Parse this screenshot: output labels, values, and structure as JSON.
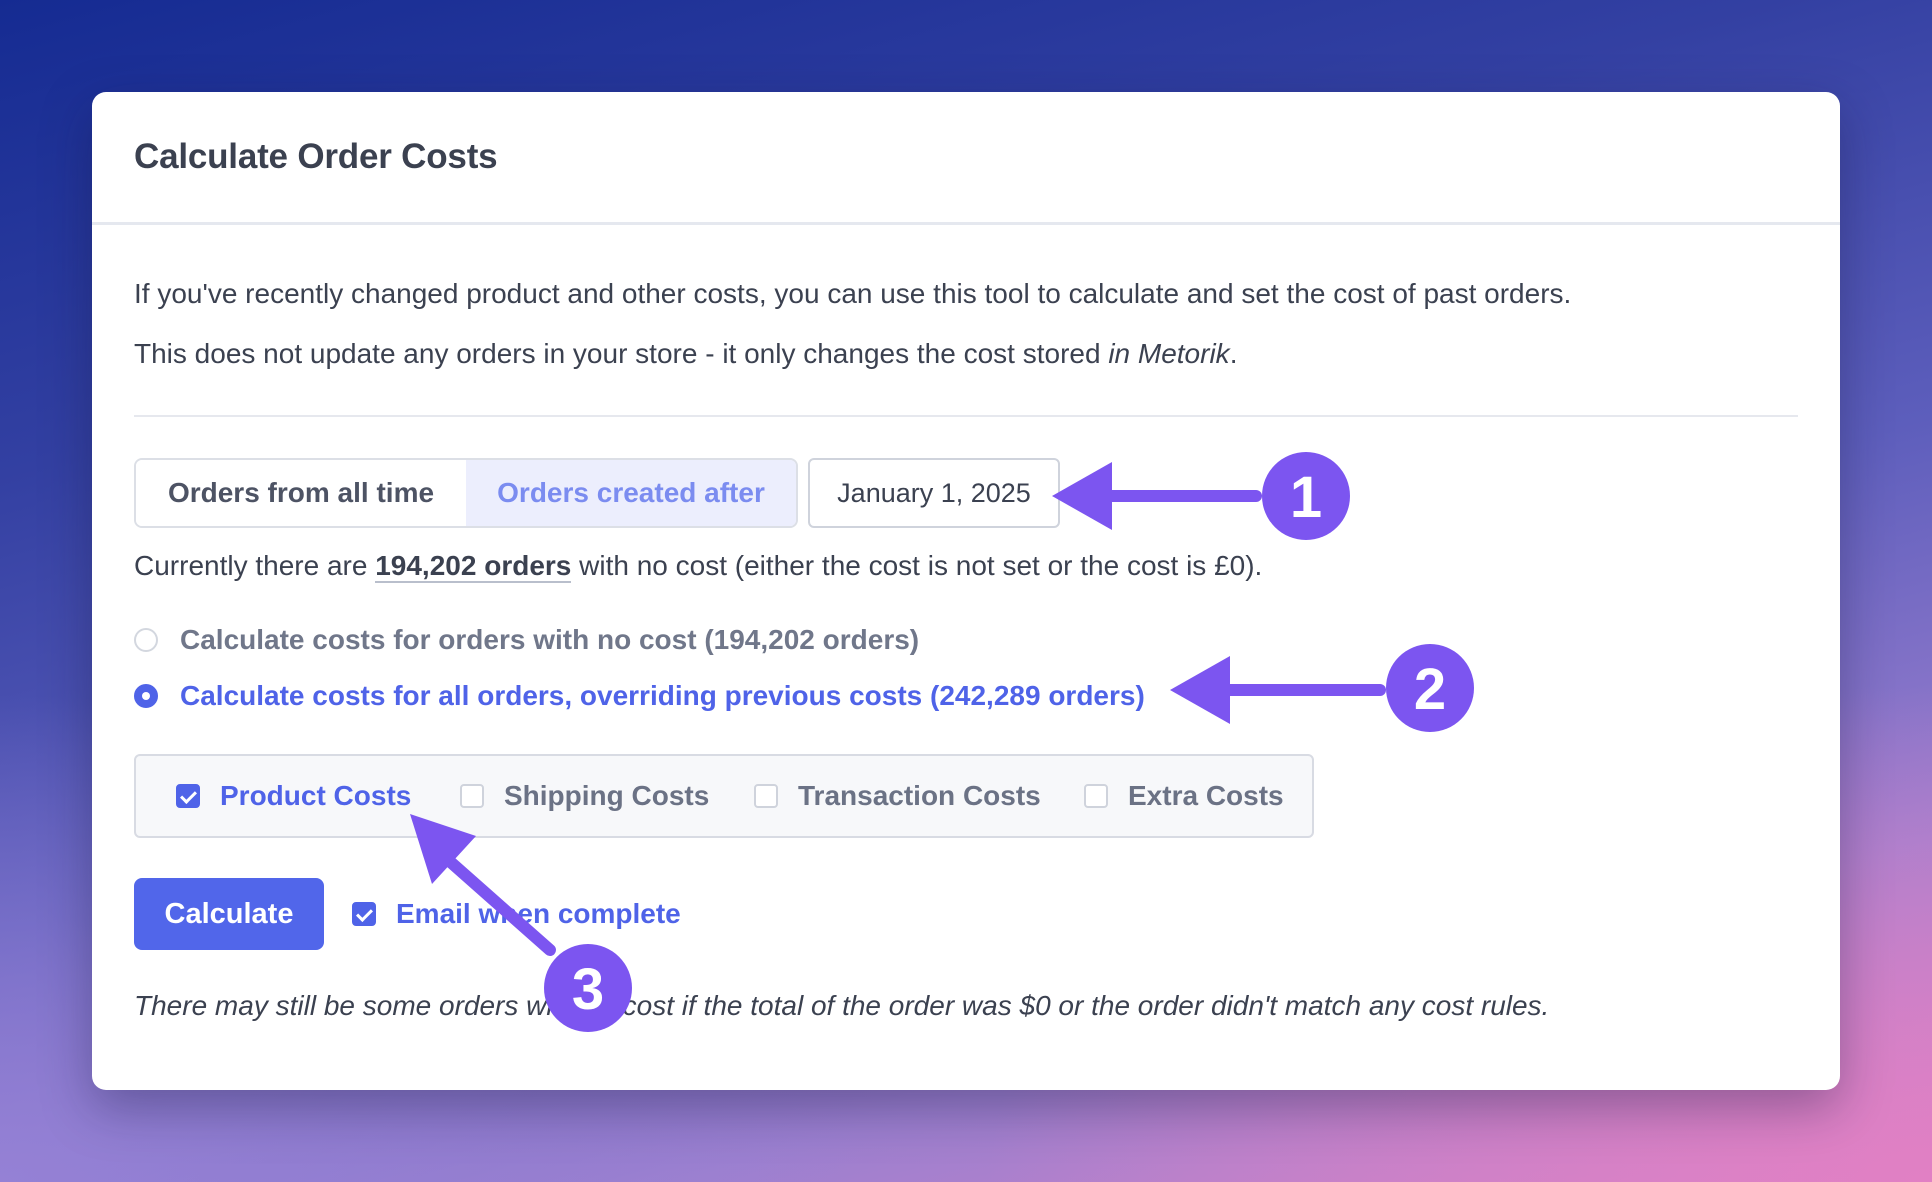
{
  "card": {
    "title": "Calculate Order Costs",
    "intro": "If you've recently changed product and other costs, you can use this tool to calculate and set the cost of past orders.",
    "notice_prefix": "This does not update any orders in your store - it only changes the cost stored ",
    "notice_emphasis": "in Metorik",
    "notice_suffix": "."
  },
  "range_toggle": {
    "options": [
      "Orders from all time",
      "Orders created after"
    ],
    "selected": "Orders created after"
  },
  "date_filter": {
    "value": "January 1, 2025"
  },
  "status": {
    "prefix": "Currently there are ",
    "count": "194,202 orders",
    "suffix": " with no cost (either the cost is not set or the cost is £0)."
  },
  "modes": [
    {
      "label": "Calculate costs for orders with no cost (194,202 orders)",
      "selected": false
    },
    {
      "label": "Calculate costs for all orders, overriding previous costs (242,289 orders)",
      "selected": true
    }
  ],
  "cost_types": [
    {
      "label": "Product Costs",
      "checked": true
    },
    {
      "label": "Shipping Costs",
      "checked": false
    },
    {
      "label": "Transaction Costs",
      "checked": false
    },
    {
      "label": "Extra Costs",
      "checked": false
    }
  ],
  "actions": {
    "calculate_label": "Calculate",
    "email_label": "Email when complete",
    "email_checked": true
  },
  "footer_note": "There may still be some orders with no cost if the total of the order was $0 or the order didn't match any cost rules.",
  "annotations": {
    "badges": [
      "1",
      "2",
      "3"
    ],
    "color": "#7c55f0"
  },
  "colors": {
    "accent": "#4f63e8",
    "toggle_active_bg": "#eceefd",
    "annotation": "#7c55f0"
  }
}
